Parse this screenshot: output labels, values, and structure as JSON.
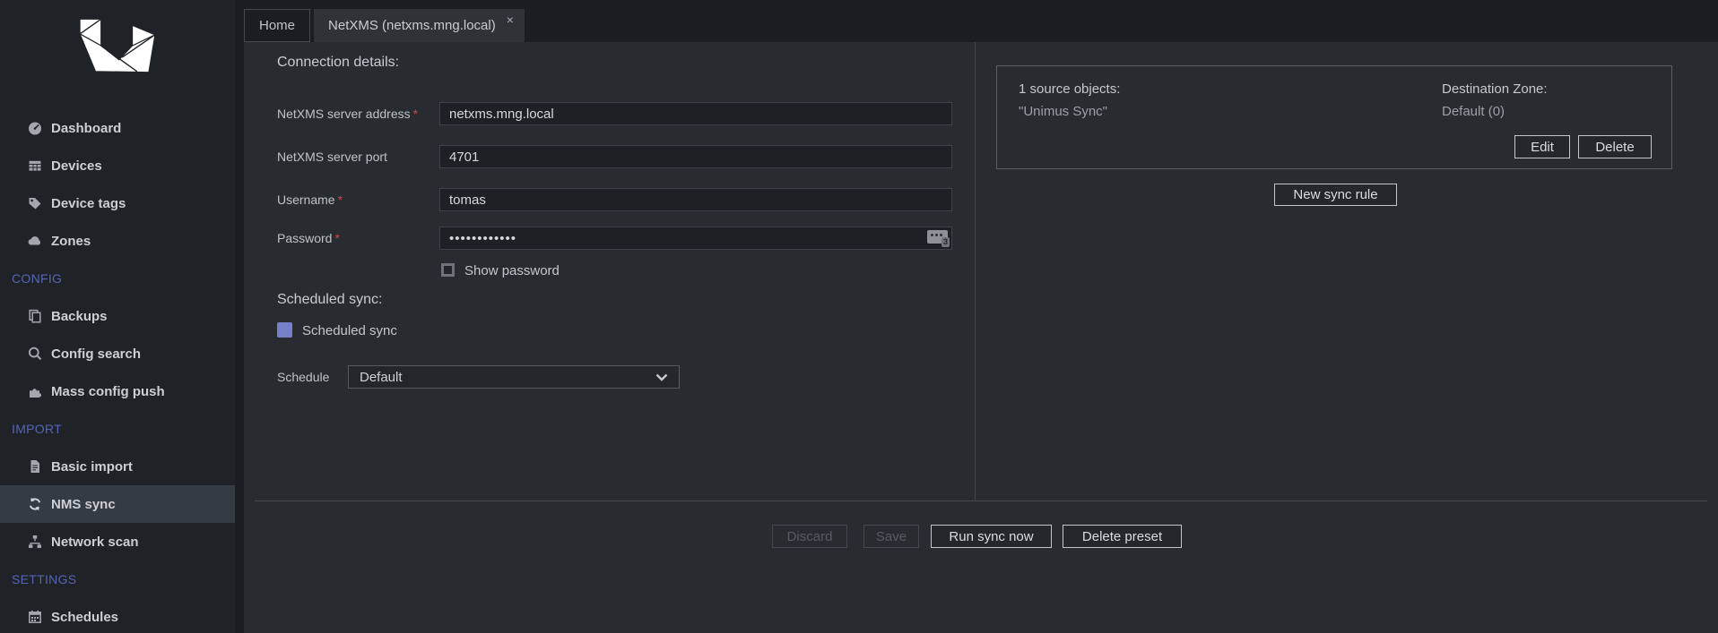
{
  "app": {
    "name": "Unimus",
    "logo": "unimus-logo"
  },
  "colors": {
    "accent_section": "#5863b4",
    "checkbox_checked": "#7580c9",
    "required": "#cc4b4b",
    "panel_bg": "#282c31",
    "sidebar_bg": "#1f2327"
  },
  "sidebar": {
    "sections": [
      "CONFIG",
      "IMPORT",
      "SETTINGS"
    ],
    "items": [
      {
        "label": "Dashboard"
      },
      {
        "label": "Devices"
      },
      {
        "label": "Device tags"
      },
      {
        "label": "Zones"
      },
      {
        "label": "Backups"
      },
      {
        "label": "Config search"
      },
      {
        "label": "Mass config push"
      },
      {
        "label": "Basic import"
      },
      {
        "label": "NMS sync",
        "active": true
      },
      {
        "label": "Network scan"
      },
      {
        "label": "Schedules"
      }
    ]
  },
  "tabs": [
    {
      "label": "Home"
    },
    {
      "label": "NetXMS (netxms.mng.local)",
      "close": "×",
      "active": true
    }
  ],
  "form": {
    "section_title": "Connection details:",
    "required_mark": "*",
    "fields": {
      "address": {
        "label": "NetXMS server address",
        "value": "netxms.mng.local"
      },
      "port": {
        "label": "NetXMS server port",
        "value": "4701"
      },
      "username": {
        "label": "Username",
        "value": "tomas"
      },
      "password": {
        "label": "Password",
        "value": "••••••••••••",
        "manager_badge": "3"
      }
    },
    "show_password_label": "Show password",
    "scheduled_sync_title": "Scheduled sync:",
    "scheduled_sync_label": "Scheduled sync",
    "schedule_label": "Schedule",
    "schedule_value": "Default"
  },
  "sync_rules": {
    "card": {
      "source_title": "1 source objects:",
      "source_value": "\"Unimus Sync\"",
      "dest_title": "Destination Zone:",
      "dest_value": "Default (0)",
      "edit_label": "Edit",
      "delete_label": "Delete"
    },
    "new_rule_label": "New sync rule"
  },
  "footer": {
    "discard": "Discard",
    "save": "Save",
    "run_sync": "Run sync now",
    "delete_preset": "Delete preset"
  }
}
